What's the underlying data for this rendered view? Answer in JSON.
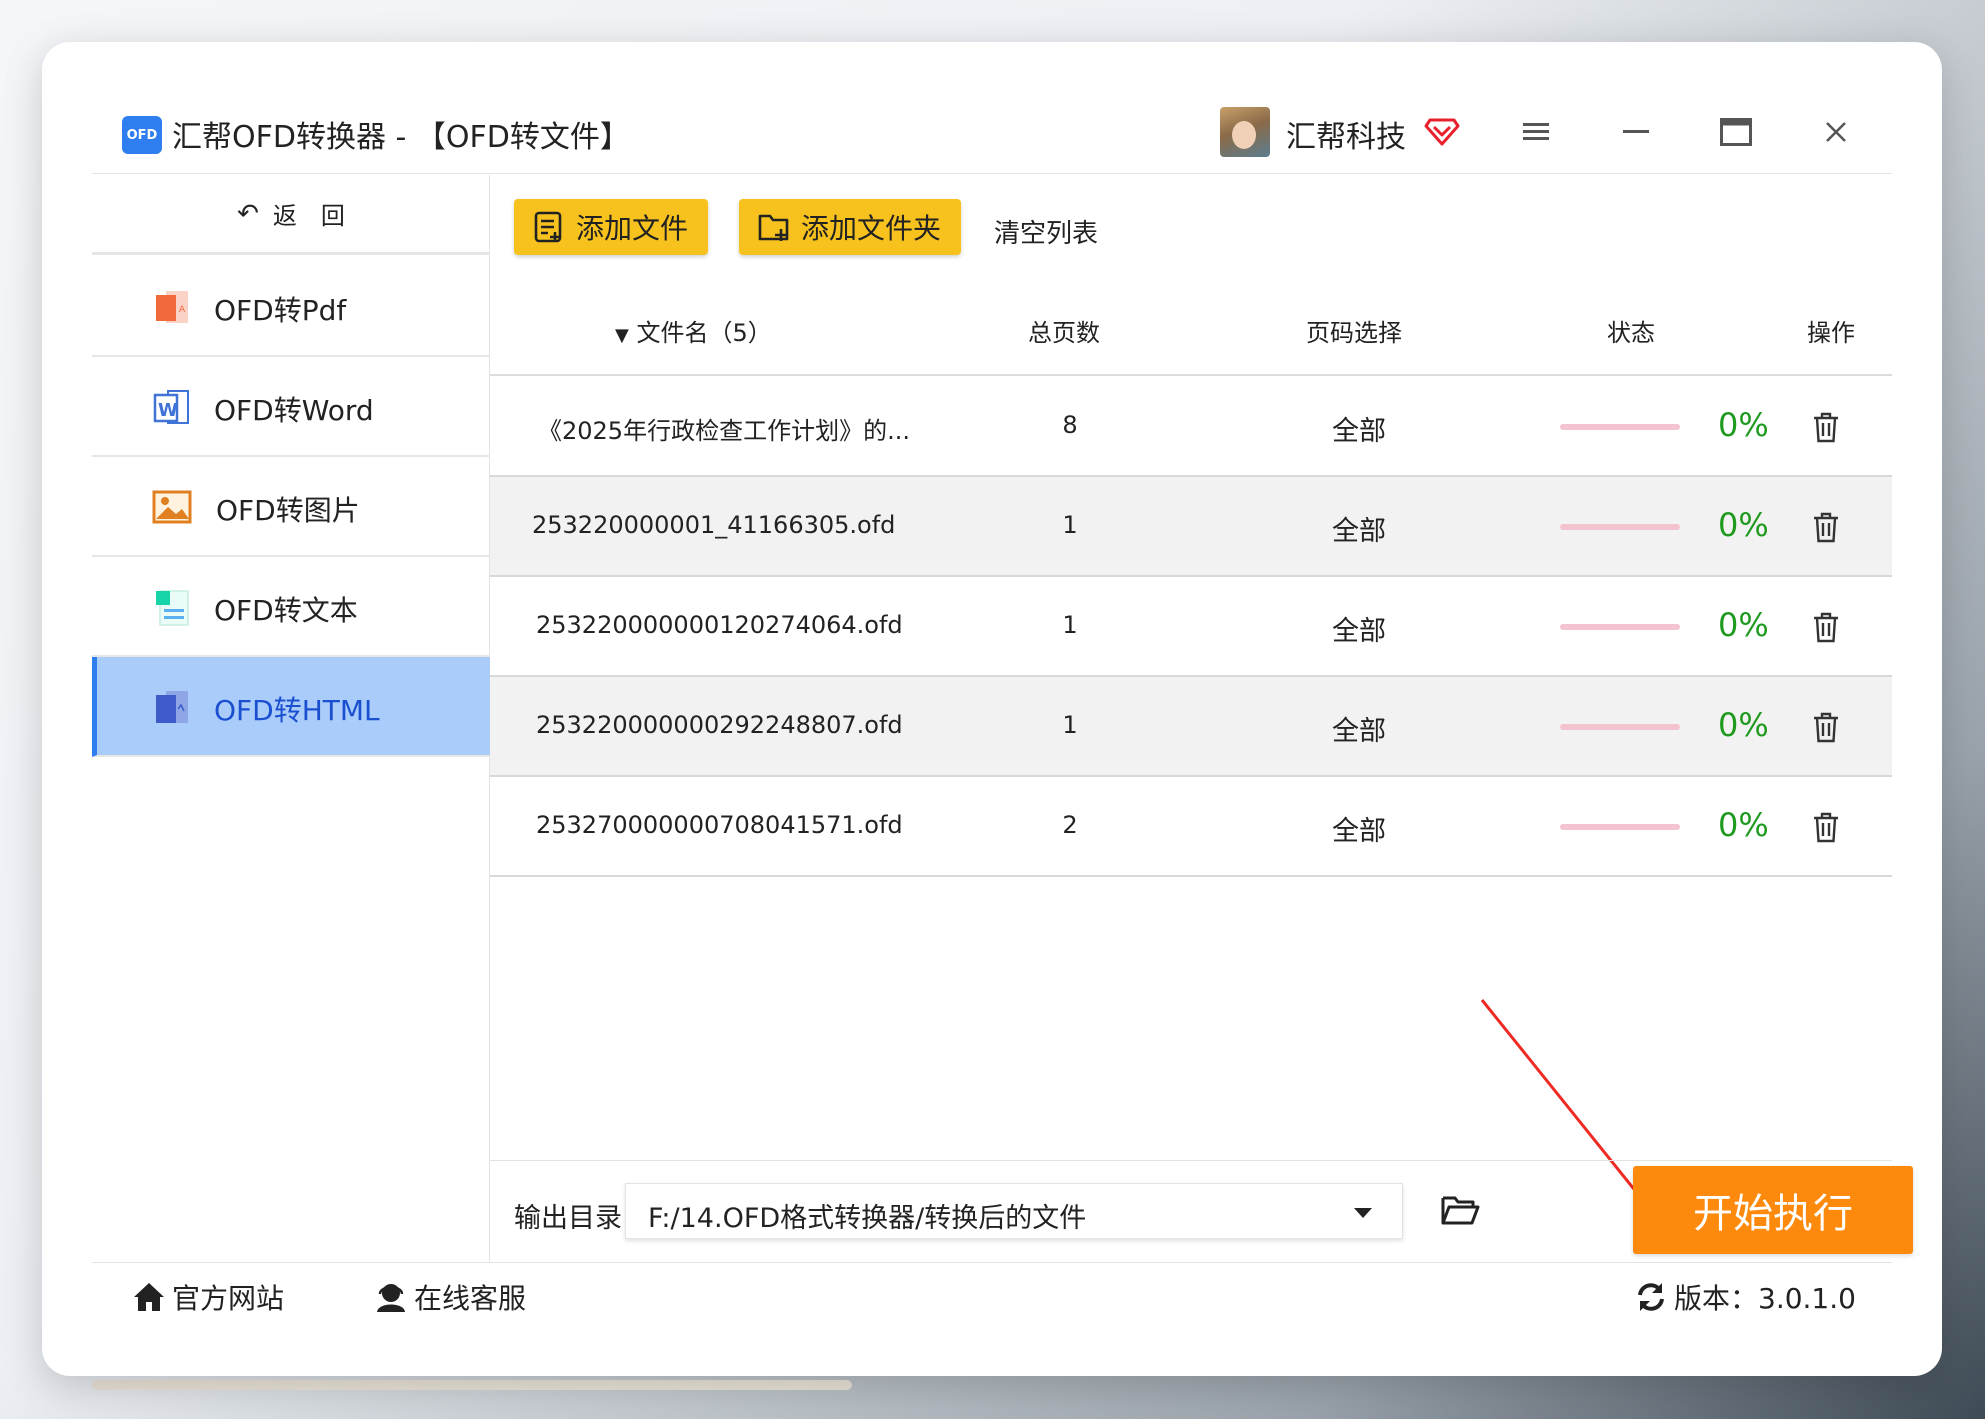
{
  "window": {
    "app_logo_text": "OFD",
    "title": "汇帮OFD转换器 - 【OFD转文件】",
    "company": "汇帮科技"
  },
  "sidebar": {
    "back_label": "返　回",
    "items": [
      {
        "label": "OFD转Pdf",
        "icon": "pdf-icon",
        "active": false
      },
      {
        "label": "OFD转Word",
        "icon": "word-icon",
        "active": false
      },
      {
        "label": "OFD转图片",
        "icon": "image-icon",
        "active": false
      },
      {
        "label": "OFD转文本",
        "icon": "text-icon",
        "active": false
      },
      {
        "label": "OFD转HTML",
        "icon": "html-icon",
        "active": true
      }
    ]
  },
  "toolbar": {
    "add_file_label": "添加文件",
    "add_folder_label": "添加文件夹",
    "clear_label": "清空列表"
  },
  "table": {
    "headers": {
      "name": "文件名（5）",
      "pages": "总页数",
      "range": "页码选择",
      "status": "状态",
      "action": "操作"
    },
    "rows": [
      {
        "name": "《2025年行政检查工作计划》的...",
        "pages": "8",
        "range": "全部",
        "progress": 0,
        "percent": "0%"
      },
      {
        "name": "253220000001_41166305.ofd",
        "pages": "1",
        "range": "全部",
        "progress": 0,
        "percent": "0%"
      },
      {
        "name": "253220000000120274064.ofd",
        "pages": "1",
        "range": "全部",
        "progress": 0,
        "percent": "0%"
      },
      {
        "name": "253220000000292248807.ofd",
        "pages": "1",
        "range": "全部",
        "progress": 0,
        "percent": "0%"
      },
      {
        "name": "253270000000708041571.ofd",
        "pages": "2",
        "range": "全部",
        "progress": 0,
        "percent": "0%"
      }
    ]
  },
  "output": {
    "label": "输出目录：",
    "path": "F:/14.OFD格式转换器/转换后的文件",
    "start_label": "开始执行"
  },
  "footer": {
    "site_label": "官方网站",
    "service_label": "在线客服",
    "version_label": "版本：3.0.1.0"
  },
  "colors": {
    "accent_yellow": "#f7c21d",
    "start_orange": "#fd8a0c",
    "active_nav": "#a9ccfb",
    "percent_green": "#1f9a1f",
    "annotation_red": "#ee2a24"
  }
}
